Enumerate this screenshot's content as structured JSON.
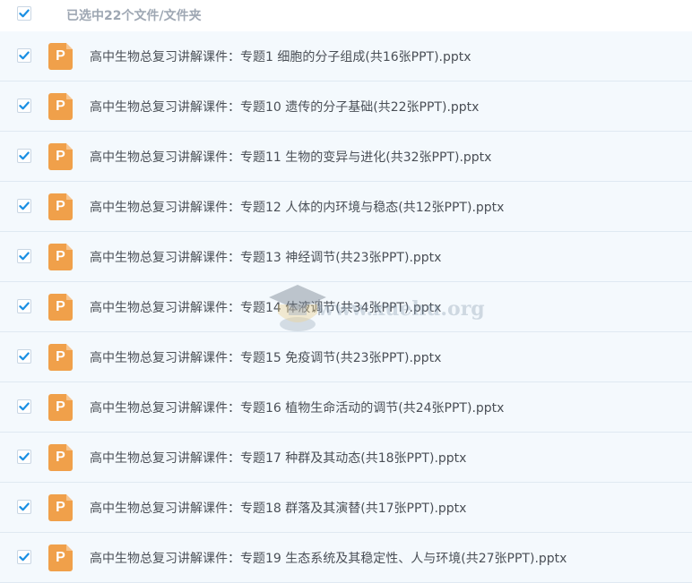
{
  "header": {
    "checked": true,
    "label": "已选中22个文件/文件夹"
  },
  "files": [
    {
      "checked": true,
      "icon": "ppt-icon",
      "icon_letter": "P",
      "name": "高中生物总复习讲解课件：专题1 细胞的分子组成(共16张PPT).pptx"
    },
    {
      "checked": true,
      "icon": "ppt-icon",
      "icon_letter": "P",
      "name": "高中生物总复习讲解课件：专题10 遗传的分子基础(共22张PPT).pptx"
    },
    {
      "checked": true,
      "icon": "ppt-icon",
      "icon_letter": "P",
      "name": "高中生物总复习讲解课件：专题11 生物的变异与进化(共32张PPT).pptx"
    },
    {
      "checked": true,
      "icon": "ppt-icon",
      "icon_letter": "P",
      "name": "高中生物总复习讲解课件：专题12 人体的内环境与稳态(共12张PPT).pptx"
    },
    {
      "checked": true,
      "icon": "ppt-icon",
      "icon_letter": "P",
      "name": "高中生物总复习讲解课件：专题13 神经调节(共23张PPT).pptx"
    },
    {
      "checked": true,
      "icon": "ppt-icon",
      "icon_letter": "P",
      "name": "高中生物总复习讲解课件：专题14 体液调节(共34张PPT).pptx"
    },
    {
      "checked": true,
      "icon": "ppt-icon",
      "icon_letter": "P",
      "name": "高中生物总复习讲解课件：专题15 免疫调节(共23张PPT).pptx"
    },
    {
      "checked": true,
      "icon": "ppt-icon",
      "icon_letter": "P",
      "name": "高中生物总复习讲解课件：专题16 植物生命活动的调节(共24张PPT).pptx"
    },
    {
      "checked": true,
      "icon": "ppt-icon",
      "icon_letter": "P",
      "name": "高中生物总复习讲解课件：专题17 种群及其动态(共18张PPT).pptx"
    },
    {
      "checked": true,
      "icon": "ppt-icon",
      "icon_letter": "P",
      "name": "高中生物总复习讲解课件：专题18 群落及其演替(共17张PPT).pptx"
    },
    {
      "checked": true,
      "icon": "ppt-icon",
      "icon_letter": "P",
      "name": "高中生物总复习讲解课件：专题19 生态系统及其稳定性、人与环境(共27张PPT).pptx"
    }
  ],
  "watermark": {
    "text": "www.xuehu.org",
    "icon": "graduation-cap-icon"
  },
  "colors": {
    "checkbox_accent": "#1a8fe3",
    "row_background": "#f4f9fd",
    "ppt_icon": "#f0a04a"
  }
}
